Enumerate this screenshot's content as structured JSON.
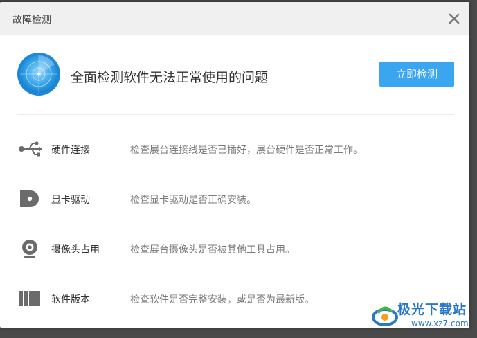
{
  "window": {
    "title": "故障检测",
    "close_icon": "close-icon"
  },
  "hero": {
    "icon": "radar-icon",
    "headline": "全面检测软件无法正常使用的问题",
    "button_label": "立即检测"
  },
  "checks": [
    {
      "icon": "usb-icon",
      "name": "硬件连接",
      "description": "检查展台连接线是否已插好，展台硬件是否正常工作。"
    },
    {
      "icon": "graphics-card-icon",
      "name": "显卡驱动",
      "description": "检查显卡驱动是否正确安装。"
    },
    {
      "icon": "webcam-icon",
      "name": "摄像头占用",
      "description": "检查展台摄像头是否被其他工具占用。"
    },
    {
      "icon": "software-version-icon",
      "name": "软件版本",
      "description": "检查软件是否完整安装，或是否为最新版。"
    }
  ],
  "watermark": {
    "logo_text": "极光下载站",
    "url": "www.xz7.com"
  },
  "colors": {
    "accent": "#3aa6f0",
    "title_bar": "#f0f0f0",
    "icon_gray": "#6b6b6b"
  }
}
